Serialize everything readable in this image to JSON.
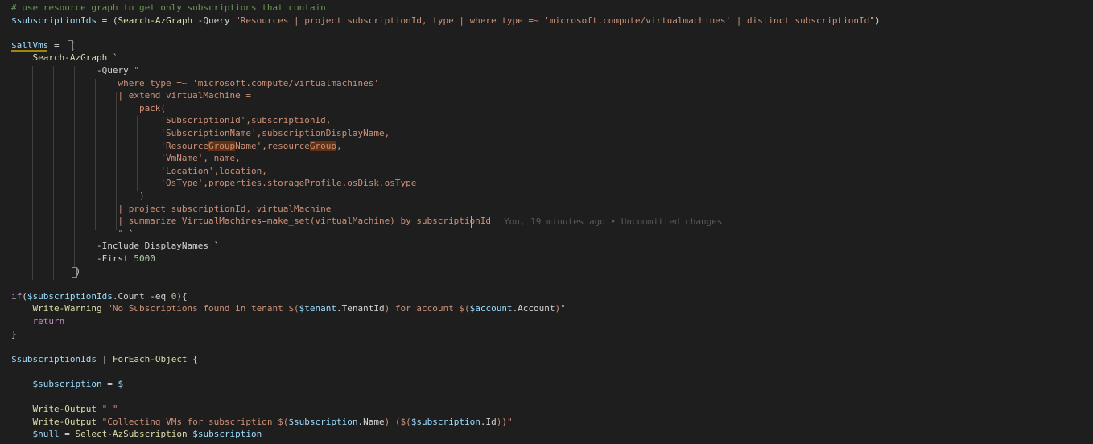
{
  "colors": {
    "background": "#1e1e1e",
    "comment": "#6a9955",
    "variable": "#9cdcfe",
    "command": "#dcdcaa",
    "string": "#ce9178",
    "keyword": "#c586c0",
    "number": "#b5cea8",
    "text": "#d4d4d4",
    "blame": "#5a5a5a"
  },
  "editor": {
    "blame_annotation": "You, 19 minutes ago • Uncommitted changes",
    "lines": [
      [
        {
          "t": "# use resource graph to get only subscriptions that contain",
          "c": "comment"
        }
      ],
      [
        {
          "t": "$subscriptionIds",
          "c": "var"
        },
        {
          "t": " = (",
          "c": "op"
        },
        {
          "t": "Search-AzGraph",
          "c": "cmd"
        },
        {
          "t": " -Query ",
          "c": "param"
        },
        {
          "t": "\"Resources | project subscriptionId, type | where type =~ 'microsoft.compute/virtualmachines' | distinct subscriptionId\"",
          "c": "str"
        },
        {
          "t": ")",
          "c": "op"
        }
      ],
      [],
      [
        {
          "t": "$allVms",
          "c": "var"
        },
        {
          "t": " =  (",
          "c": "op"
        }
      ],
      [
        {
          "t": "    ",
          "c": "op"
        },
        {
          "t": "Search-AzGraph",
          "c": "cmd"
        },
        {
          "t": " `",
          "c": "op"
        }
      ],
      [
        {
          "t": "                ",
          "c": "op"
        },
        {
          "t": "-Query ",
          "c": "param"
        },
        {
          "t": "\"",
          "c": "str"
        }
      ],
      [
        {
          "t": "                    where type =~ 'microsoft.compute/virtualmachines'",
          "c": "str"
        }
      ],
      [
        {
          "t": "                    | extend virtualMachine =",
          "c": "str"
        }
      ],
      [
        {
          "t": "                        pack(",
          "c": "str"
        }
      ],
      [
        {
          "t": "                            'SubscriptionId',subscriptionId,",
          "c": "str"
        }
      ],
      [
        {
          "t": "                            'SubscriptionName',subscriptionDisplayName,",
          "c": "str"
        }
      ],
      [
        {
          "t": "                            'Resource",
          "c": "str"
        },
        {
          "t": "Group",
          "c": "str",
          "hl": true
        },
        {
          "t": "Name',resource",
          "c": "str"
        },
        {
          "t": "Group",
          "c": "str",
          "hl": true
        },
        {
          "t": ",",
          "c": "str"
        }
      ],
      [
        {
          "t": "                            'VmName', name,",
          "c": "str"
        }
      ],
      [
        {
          "t": "                            'Location',location,",
          "c": "str"
        }
      ],
      [
        {
          "t": "                            'OsType',properties.storageProfile.osDisk.osType",
          "c": "str"
        }
      ],
      [
        {
          "t": "                        )",
          "c": "str"
        }
      ],
      [
        {
          "t": "                    | project subscriptionId, virtualMachine",
          "c": "str"
        }
      ],
      [
        {
          "t": "                    | summarize VirtualMachines=make_set(virtualMachine) by subscriptionId",
          "c": "str"
        }
      ],
      [
        {
          "t": "                    \"",
          "c": "str"
        },
        {
          "t": " `",
          "c": "op"
        }
      ],
      [
        {
          "t": "                ",
          "c": "op"
        },
        {
          "t": "-Include DisplayNames `",
          "c": "param"
        }
      ],
      [
        {
          "t": "                ",
          "c": "op"
        },
        {
          "t": "-First ",
          "c": "param"
        },
        {
          "t": "5000",
          "c": "num"
        }
      ],
      [
        {
          "t": "            )",
          "c": "op"
        }
      ],
      [],
      [
        {
          "t": "if",
          "c": "kw"
        },
        {
          "t": "(",
          "c": "op"
        },
        {
          "t": "$subscriptionIds",
          "c": "var"
        },
        {
          "t": ".Count -eq ",
          "c": "op"
        },
        {
          "t": "0",
          "c": "num"
        },
        {
          "t": "){",
          "c": "op"
        }
      ],
      [
        {
          "t": "    ",
          "c": "op"
        },
        {
          "t": "Write-Warning",
          "c": "cmd"
        },
        {
          "t": " ",
          "c": "op"
        },
        {
          "t": "\"No Subscriptions found in tenant $(",
          "c": "str"
        },
        {
          "t": "$tenant",
          "c": "var"
        },
        {
          "t": ".TenantId",
          "c": "op"
        },
        {
          "t": ") for account $(",
          "c": "str"
        },
        {
          "t": "$account",
          "c": "var"
        },
        {
          "t": ".Account",
          "c": "op"
        },
        {
          "t": ")\"",
          "c": "str"
        }
      ],
      [
        {
          "t": "    ",
          "c": "op"
        },
        {
          "t": "return",
          "c": "kw"
        }
      ],
      [
        {
          "t": "}",
          "c": "op"
        }
      ],
      [],
      [
        {
          "t": "$subscriptionIds",
          "c": "var"
        },
        {
          "t": " | ",
          "c": "op"
        },
        {
          "t": "ForEach-Object",
          "c": "cmd"
        },
        {
          "t": " {",
          "c": "op"
        }
      ],
      [],
      [
        {
          "t": "    ",
          "c": "op"
        },
        {
          "t": "$subscription",
          "c": "var"
        },
        {
          "t": " = ",
          "c": "op"
        },
        {
          "t": "$_",
          "c": "var"
        }
      ],
      [],
      [
        {
          "t": "    ",
          "c": "op"
        },
        {
          "t": "Write-Output",
          "c": "cmd"
        },
        {
          "t": " ",
          "c": "op"
        },
        {
          "t": "\" \"",
          "c": "str"
        }
      ],
      [
        {
          "t": "    ",
          "c": "op"
        },
        {
          "t": "Write-Output",
          "c": "cmd"
        },
        {
          "t": " ",
          "c": "op"
        },
        {
          "t": "\"Collecting VMs for subscription $(",
          "c": "str"
        },
        {
          "t": "$subscription",
          "c": "var"
        },
        {
          "t": ".Name",
          "c": "op"
        },
        {
          "t": ") ($(",
          "c": "str"
        },
        {
          "t": "$subscription",
          "c": "var"
        },
        {
          "t": ".Id",
          "c": "op"
        },
        {
          "t": "))\"",
          "c": "str"
        }
      ],
      [
        {
          "t": "    ",
          "c": "op"
        },
        {
          "t": "$null",
          "c": "var"
        },
        {
          "t": " = ",
          "c": "op"
        },
        {
          "t": "Select-AzSubscription",
          "c": "cmd"
        },
        {
          "t": " ",
          "c": "op"
        },
        {
          "t": "$subscription",
          "c": "var"
        }
      ]
    ]
  }
}
